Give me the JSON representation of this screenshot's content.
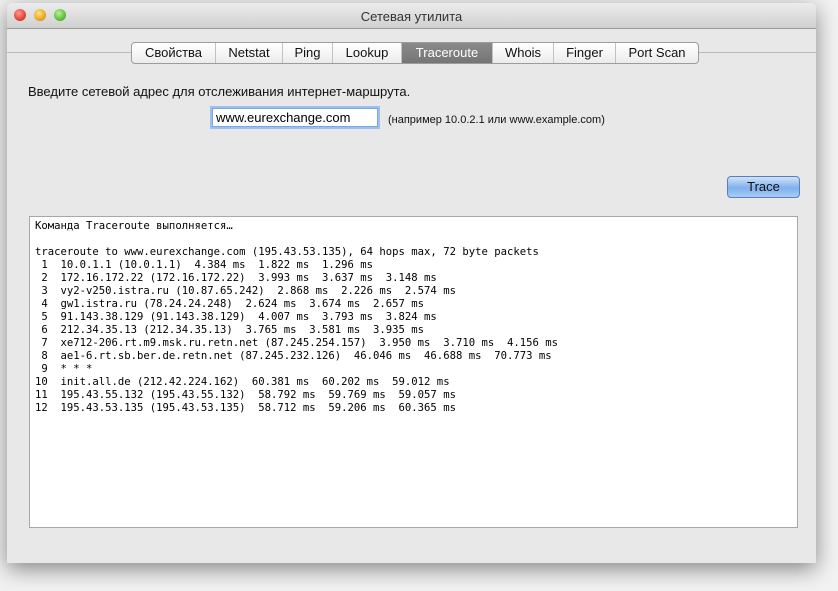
{
  "window": {
    "title": "Сетевая утилита"
  },
  "tabs": [
    {
      "label": "Свойства"
    },
    {
      "label": "Netstat"
    },
    {
      "label": "Ping"
    },
    {
      "label": "Lookup"
    },
    {
      "label": "Traceroute"
    },
    {
      "label": "Whois"
    },
    {
      "label": "Finger"
    },
    {
      "label": "Port Scan"
    }
  ],
  "active_tab": "Traceroute",
  "form": {
    "prompt": "Введите сетевой адрес для отслеживания интернет-маршрута.",
    "address": "www.eurexchange.com",
    "hint": "(например 10.0.2.1 или www.example.com)",
    "trace_label": "Trace"
  },
  "output": {
    "lines": [
      "Команда Traceroute выполняется…",
      "",
      "traceroute to www.eurexchange.com (195.43.53.135), 64 hops max, 72 byte packets",
      " 1  10.0.1.1 (10.0.1.1)  4.384 ms  1.822 ms  1.296 ms",
      " 2  172.16.172.22 (172.16.172.22)  3.993 ms  3.637 ms  3.148 ms",
      " 3  vy2-v250.istra.ru (10.87.65.242)  2.868 ms  2.226 ms  2.574 ms",
      " 4  gw1.istra.ru (78.24.24.248)  2.624 ms  3.674 ms  2.657 ms",
      " 5  91.143.38.129 (91.143.38.129)  4.007 ms  3.793 ms  3.824 ms",
      " 6  212.34.35.13 (212.34.35.13)  3.765 ms  3.581 ms  3.935 ms",
      " 7  xe712-206.rt.m9.msk.ru.retn.net (87.245.254.157)  3.950 ms  3.710 ms  4.156 ms",
      " 8  ae1-6.rt.sb.ber.de.retn.net (87.245.232.126)  46.046 ms  46.688 ms  70.773 ms",
      " 9  * * *",
      "10  init.all.de (212.42.224.162)  60.381 ms  60.202 ms  59.012 ms",
      "11  195.43.55.132 (195.43.55.132)  58.792 ms  59.769 ms  59.057 ms",
      "12  195.43.53.135 (195.43.53.135)  58.712 ms  59.206 ms  60.365 ms"
    ]
  }
}
